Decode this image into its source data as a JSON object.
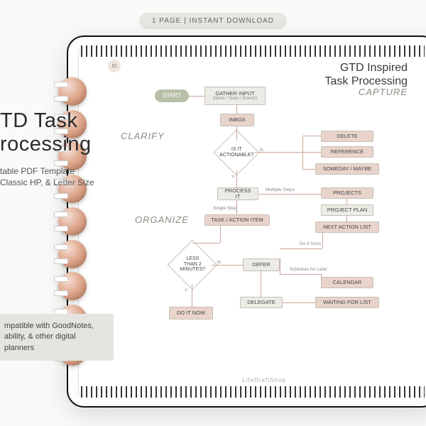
{
  "badge": "1 PAGE  |  INSTANT DOWNLOAD",
  "title1": "TD Task",
  "title2": "rocessing",
  "sub_line1": "table PDF Template",
  "sub_line2": "Classic HP, & Letter Size",
  "compat1": "mpatible with GoodNotes,",
  "compat2": "ability, & other digital planners",
  "page_title1": "GTD Inspired",
  "page_title2": "Task Processing",
  "stages": {
    "capture": "CAPTURE",
    "clarify": "CLARIFY",
    "organize": "ORGANIZE"
  },
  "nodes": {
    "start": "START",
    "gather": "GATHER INPUT",
    "gather_sub": "(Items / Tasks / Events)",
    "inbox": "INBOX",
    "actionable": "IS IT ACTIONABLE?",
    "delete": "DELETE",
    "reference": "REFERENCE",
    "someday": "SOMEDAY / MAYBE",
    "process": "PROCESS IT",
    "projects": "PROJECTS",
    "project_plan": "PROJECT PLAN",
    "next_action": "NEXT ACTION LIST",
    "task_item": "TASK / ACTION ITEM",
    "less2": "LESS THAN 2 MINUTES?",
    "defer": "DEFER",
    "calendar": "CALENDAR",
    "delegate": "DELEGATE",
    "waiting": "WAITING FOR LIST",
    "doit": "DO IT NOW"
  },
  "labels": {
    "y": "Y",
    "n": "N",
    "multi": "Multiple Steps",
    "single": "Single Step",
    "soon": "Do it Soon",
    "later": "Schedule for Later"
  },
  "brand": "LifeDraftShop"
}
